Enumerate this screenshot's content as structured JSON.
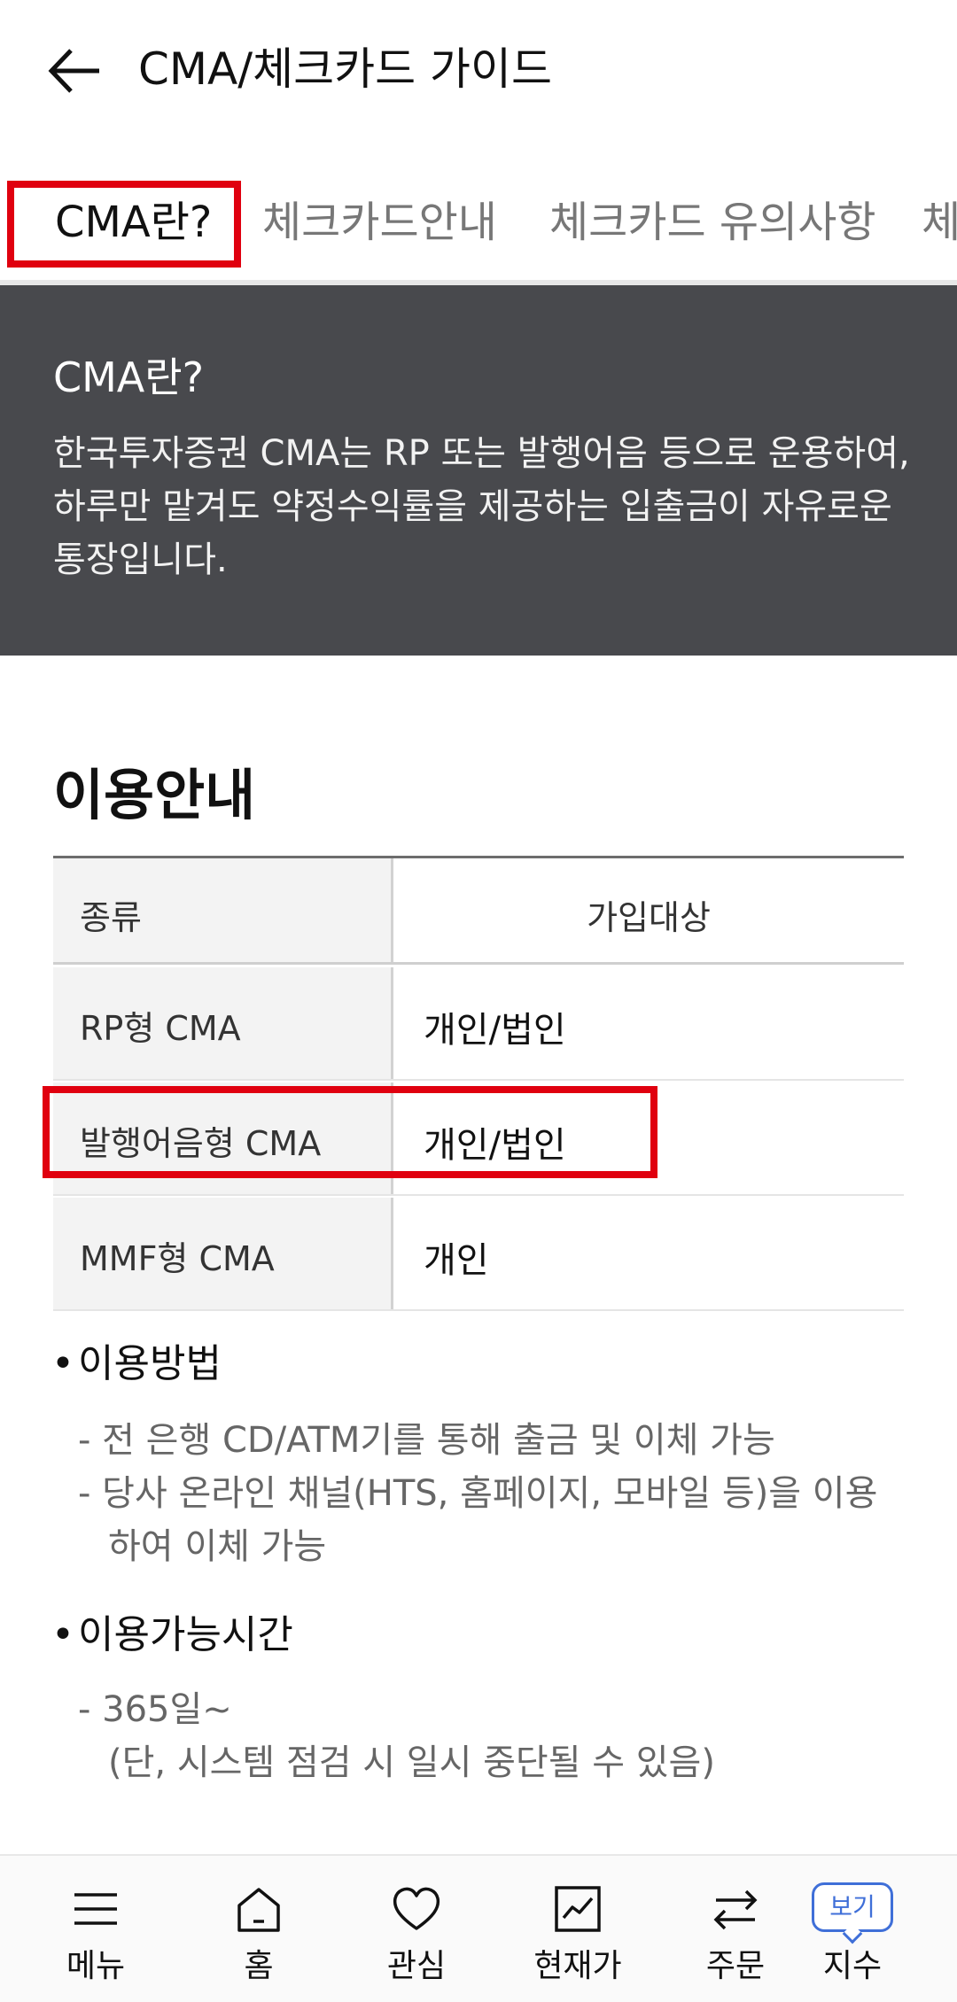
{
  "header": {
    "title": "CMA/체크카드 가이드"
  },
  "tabs": [
    {
      "label": "CMA란?"
    },
    {
      "label": "체크카드안내"
    },
    {
      "label": "체크카드 유의사항"
    },
    {
      "label": "체"
    }
  ],
  "intro": {
    "title": "CMA란?",
    "description": "한국투자증권 CMA는 RP 또는 발행어음 등으로 운용하여, 하루만 맡겨도 약정수익률을 제공하는 입출금이 자유로운 통장입니다."
  },
  "section": {
    "title": "이용안내"
  },
  "table": {
    "headers": [
      "종류",
      "가입대상"
    ],
    "rows": [
      {
        "type": "RP형 CMA",
        "target": "개인/법인"
      },
      {
        "type": "발행어음형 CMA",
        "target": "개인/법인"
      },
      {
        "type": "MMF형 CMA",
        "target": "개인"
      }
    ]
  },
  "usage": {
    "method_title": "이용방법",
    "method_items": [
      "- 전 은행 CD/ATM기를 통해 출금 및 이체 가능",
      "- 당사 온라인 채널(HTS, 홈페이지, 모바일 등)을 이용",
      "하여 이체 가능"
    ],
    "time_title": "이용가능시간",
    "time_items": [
      "- 365일~",
      "(단, 시스템 점검 시 일시 중단될 수 있음)"
    ]
  },
  "bottom_nav": [
    {
      "label": "메뉴",
      "icon": "menu-icon"
    },
    {
      "label": "홈",
      "icon": "home-icon"
    },
    {
      "label": "관심",
      "icon": "heart-icon"
    },
    {
      "label": "현재가",
      "icon": "chart-icon"
    },
    {
      "label": "주문",
      "icon": "swap-icon"
    },
    {
      "label": "지수",
      "icon": "speech-badge-icon",
      "badge": "보기"
    }
  ],
  "colors": {
    "highlight": "#e0000f",
    "intro_bg": "#48494d",
    "badge": "#3f6fd8"
  }
}
